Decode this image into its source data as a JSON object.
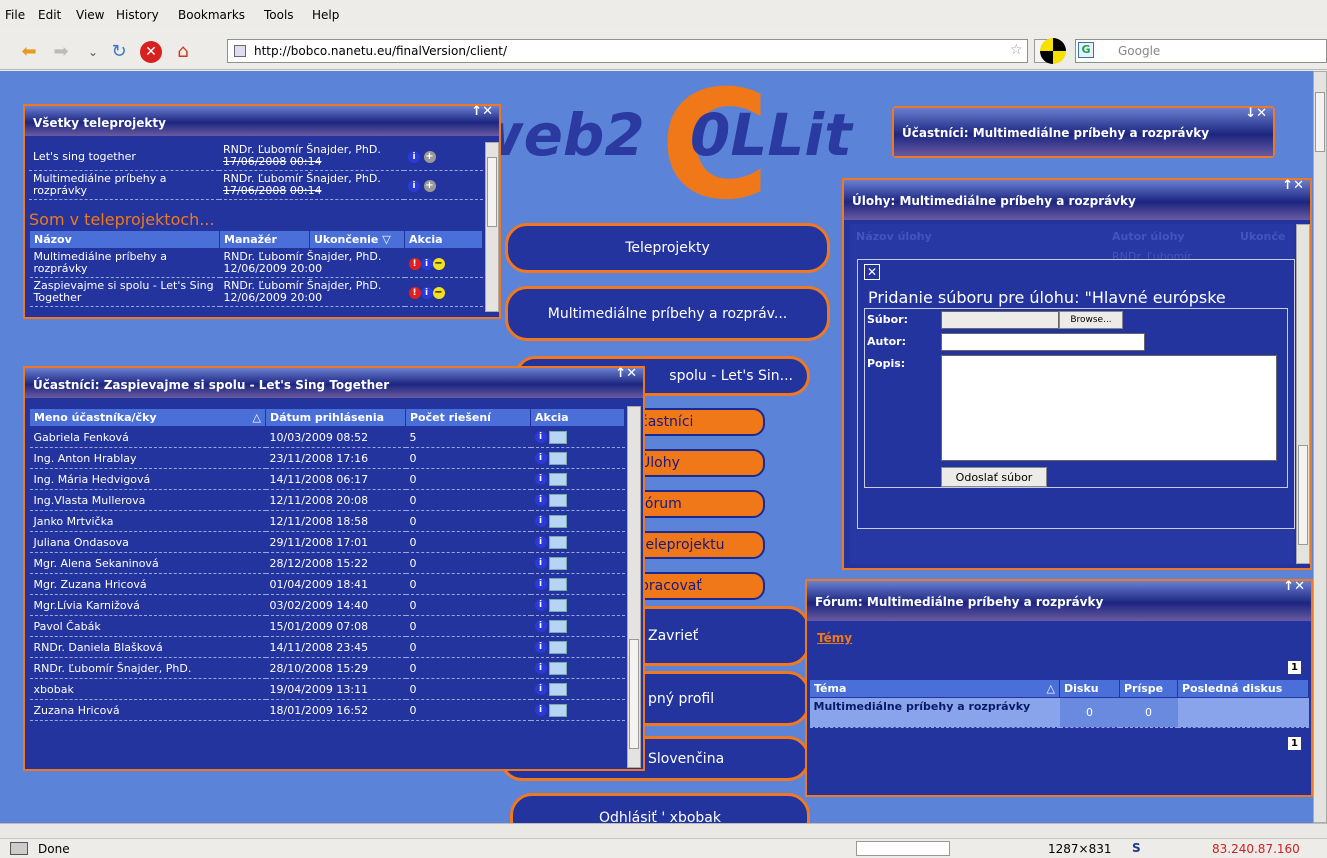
{
  "menu": [
    "File",
    "Edit",
    "View",
    "History",
    "Bookmarks",
    "Tools",
    "Help"
  ],
  "browser": {
    "url": "http://bobco.nanetu.eu/finalVersion/client/",
    "search_placeholder": "Google",
    "status": "Done",
    "resolution": "1287×831",
    "ip": "83.240.87.160"
  },
  "logo": {
    "text": "web2",
    "text2": "0LLit"
  },
  "nav": {
    "teleprojekty": "Teleprojekty",
    "mm": "Multimediálne príbehy a rozpráv...",
    "spolu": "spolu - Let's Sin...",
    "ucastnici": "častníci",
    "ulohy": "Úlohy",
    "forum": "fórum",
    "telepr": "teleprojektu",
    "pracovat": "pracovať",
    "zavriet": "Zavrieť",
    "profil": "pný profil",
    "lang": "Slovenčina",
    "logout": "Odhlásiť ' xbobak"
  },
  "allProjects": {
    "title": "Všetky teleprojekty",
    "ctrl": "↑✕",
    "rows": [
      {
        "name": "Let's sing together",
        "manager": "RNDr. Ľubomír Šnajder, PhD.",
        "date": "17/06/2008",
        "time": "00:14"
      },
      {
        "name": "Multimediálne príbehy a rozprávky",
        "manager": "RNDr. Ľubomír Šnajder, PhD.",
        "date": "17/06/2008",
        "time": "00:14"
      }
    ],
    "section": "Som v teleprojektoch...",
    "headers": [
      "Názov",
      "Manažér",
      "Ukončenie",
      "Akcia"
    ],
    "mine": [
      {
        "name": "Multimediálne príbehy a rozprávky",
        "manager": "RNDr. Ľubomír Šnajder, PhD.",
        "date": "12/06/2009",
        "time": "20:00"
      },
      {
        "name": "Zaspievajme si spolu - Let's Sing Together",
        "manager": "RNDr. Ľubomír Šnajder, PhD.",
        "date": "12/06/2009",
        "time": "20:00"
      }
    ]
  },
  "participants": {
    "title": "Účastníci: Zaspievajme si spolu - Let's Sing Together",
    "ctrl": "↑✕",
    "headers": [
      "Meno účastníka/čky",
      "Dátum prihlásenia",
      "Počet riešení",
      "Akcia"
    ],
    "rows": [
      [
        "Gabriela Fenková",
        "10/03/2009 08:52",
        "5"
      ],
      [
        "Ing. Anton Hrablay",
        "23/11/2008 17:16",
        "0"
      ],
      [
        "Ing. Mária Hedvigová",
        "14/11/2008 06:17",
        "0"
      ],
      [
        "Ing.Vlasta Mullerova",
        "12/11/2008 20:08",
        "0"
      ],
      [
        "Janko Mrtvička",
        "12/11/2008 18:58",
        "0"
      ],
      [
        "Juliana Ondasova",
        "29/11/2008 17:01",
        "0"
      ],
      [
        "Mgr. Alena Sekaninová",
        "28/12/2008 15:22",
        "0"
      ],
      [
        "Mgr. Zuzana Hricová",
        "01/04/2009 18:41",
        "0"
      ],
      [
        "Mgr.Lívia Karnižová",
        "03/02/2009 14:40",
        "0"
      ],
      [
        "Pavol Čabák",
        "15/01/2009 07:08",
        "0"
      ],
      [
        "RNDr. Daniela Blašková",
        "14/11/2008 23:45",
        "0"
      ],
      [
        "RNDr. Ľubomír Šnajder, PhD.",
        "28/10/2008 15:29",
        "0"
      ],
      [
        "xbobak",
        "19/04/2009 13:11",
        "0"
      ],
      [
        "Zuzana Hricová",
        "18/01/2009 16:52",
        "0"
      ]
    ]
  },
  "mmParticipants": {
    "title": "Účastníci: Multimediálne príbehy a rozprávky",
    "ctrl": "↓✕"
  },
  "tasks": {
    "title": "Úlohy: Multimediálne príbehy a rozprávky",
    "ctrl": "↑✕",
    "h1": "Názov úlohy",
    "h2": "Autor úlohy",
    "h3": "Ukonče",
    "bg_author": "RNDr. Ľubomír"
  },
  "upload": {
    "close": "✕",
    "title": "Pridanie súboru pre úlohu: \"Hlavné európske",
    "file": "Súbor:",
    "author": "Autor:",
    "desc": "Popis:",
    "browse": "Browse...",
    "submit": "Odoslať súbor"
  },
  "forum": {
    "title": "Fórum: Multimediálne príbehy a rozprávky",
    "ctrl": "↑✕",
    "link": "Témy",
    "page": "1",
    "headers": [
      "Téma",
      "Disku",
      "Príspe",
      "Posledná diskus"
    ],
    "rows": [
      [
        "Multimediálne príbehy a rozprávky",
        "0",
        "0",
        ""
      ]
    ]
  }
}
